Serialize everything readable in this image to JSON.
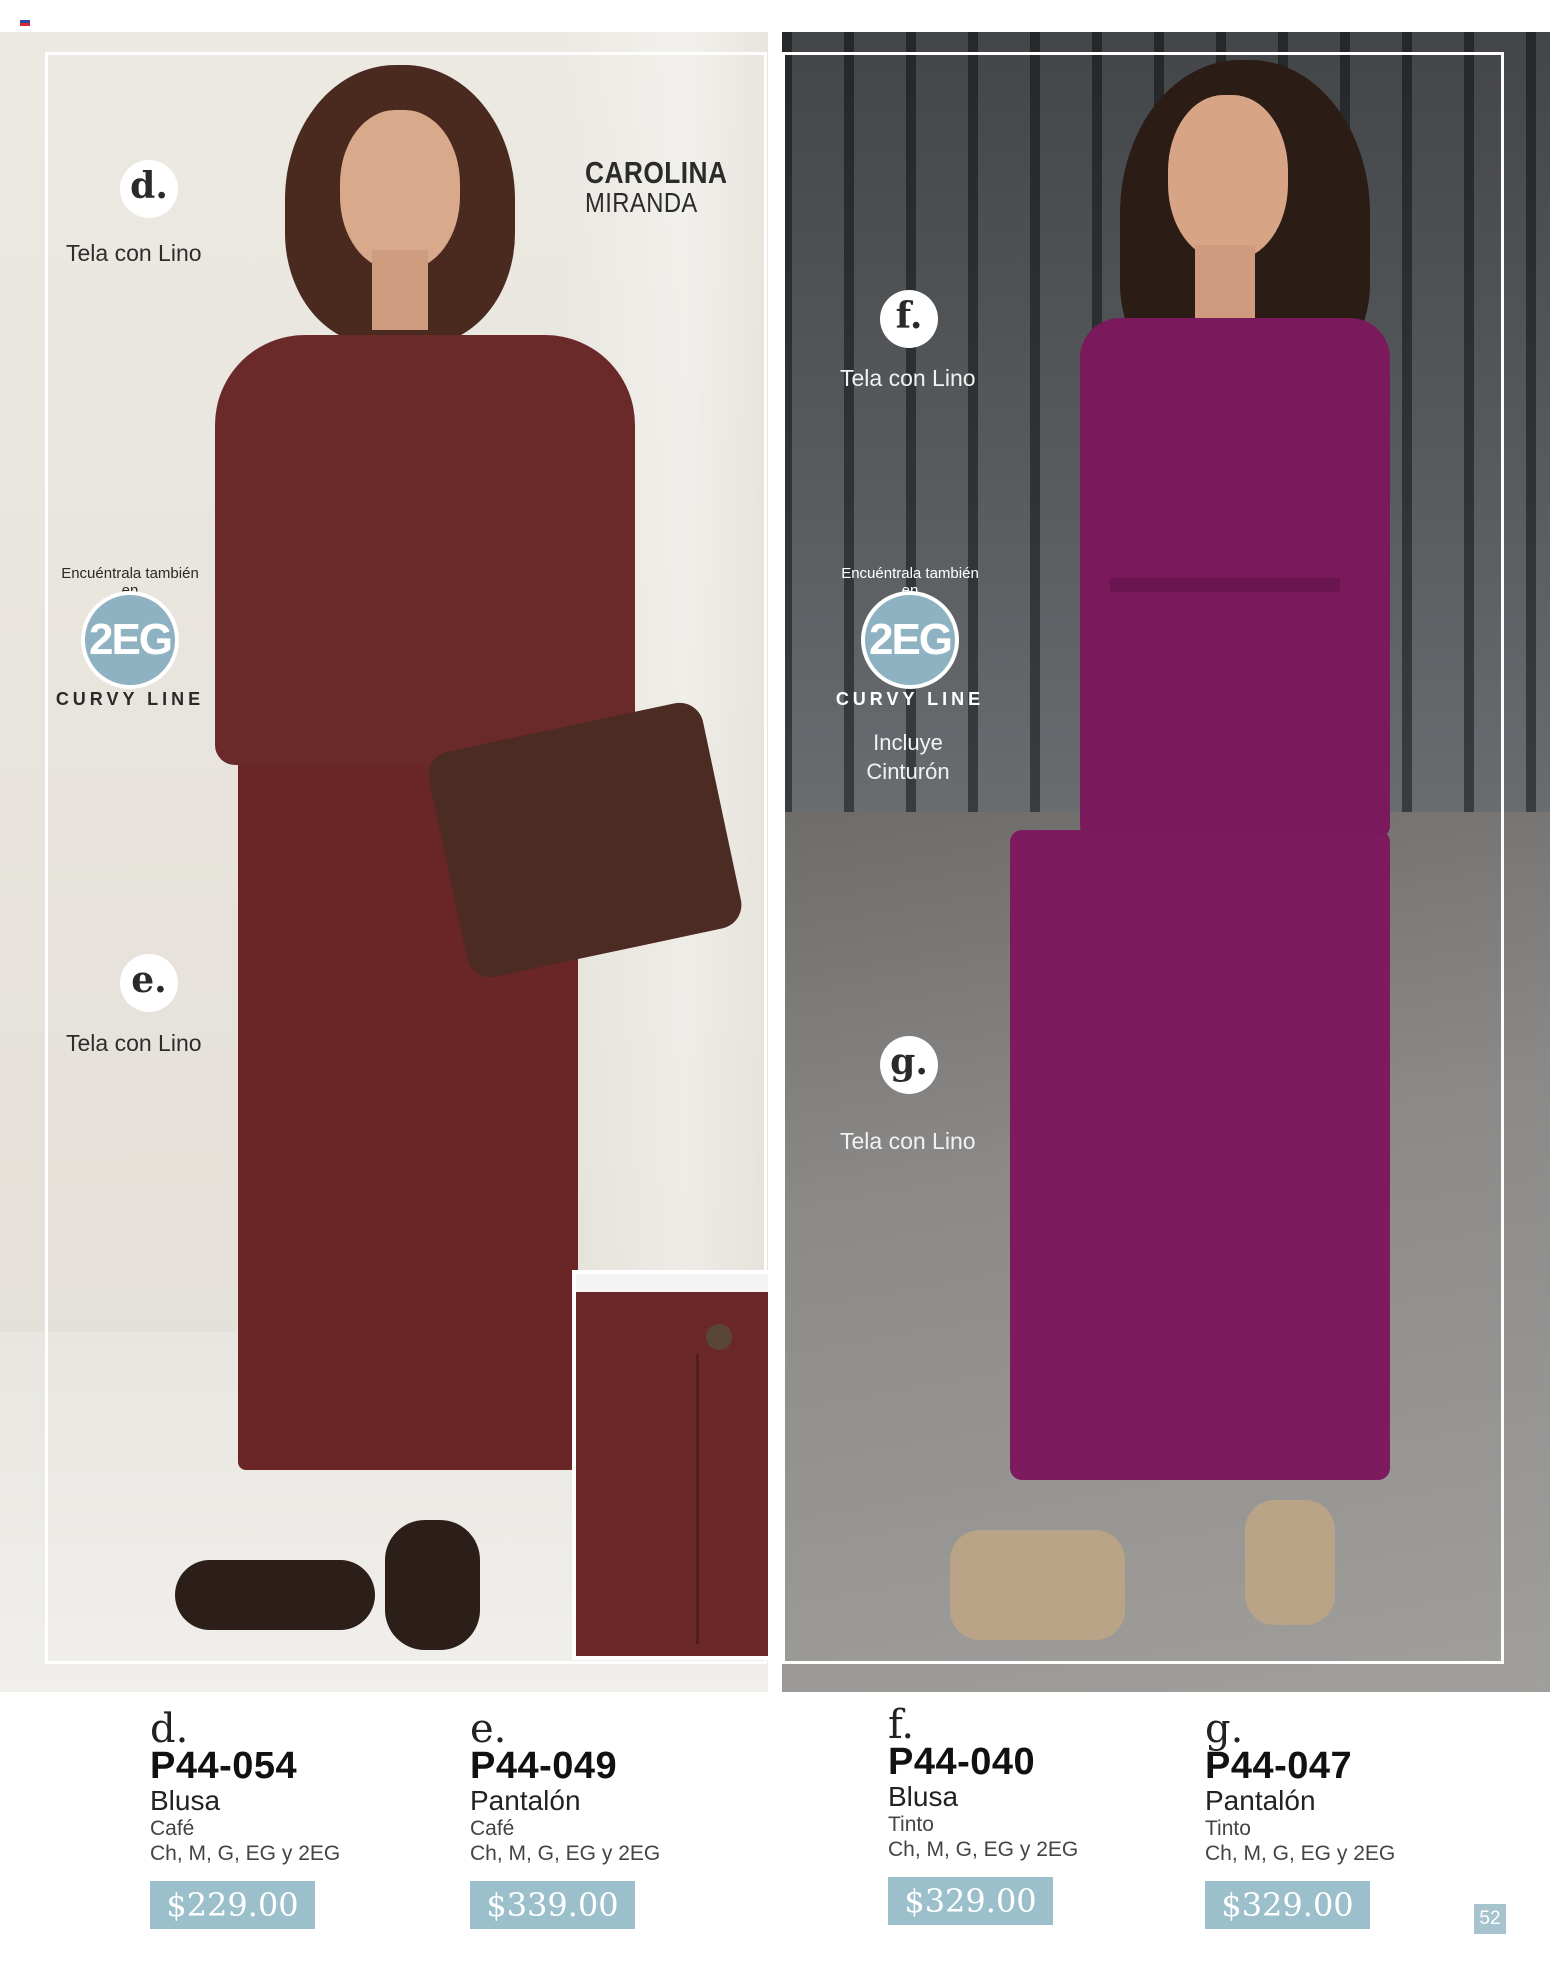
{
  "designer": {
    "first": "CAROLINA",
    "last": "MIRANDA"
  },
  "badges": [
    {
      "letter": "d.",
      "fabric": "Tela con Lino"
    },
    {
      "letter": "e.",
      "fabric": "Tela con Lino"
    },
    {
      "letter": "f.",
      "fabric": "Tela con Lino"
    },
    {
      "letter": "g.",
      "fabric": "Tela con Lino"
    }
  ],
  "stamp": {
    "arc_top": "Encuéntrala también en",
    "code": "2EG",
    "arc_bottom": "CURVY LINE"
  },
  "belt_note": "Incluye Cinturón",
  "products": [
    {
      "letter": "d.",
      "code": "P44-054",
      "name": "Blusa",
      "color": "Café",
      "sizes": "Ch, M, G, EG y 2EG",
      "price": "$229.00"
    },
    {
      "letter": "e.",
      "code": "P44-049",
      "name": "Pantalón",
      "color": "Café",
      "sizes": "Ch, M, G, EG y 2EG",
      "price": "$339.00"
    },
    {
      "letter": "f.",
      "code": "P44-040",
      "name": "Blusa",
      "color": "Tinto",
      "sizes": "Ch, M, G, EG y 2EG",
      "price": "$329.00"
    },
    {
      "letter": "g.",
      "code": "P44-047",
      "name": "Pantalón",
      "color": "Tinto",
      "sizes": "Ch, M, G, EG y 2EG",
      "price": "$329.00"
    }
  ],
  "page_number": "52",
  "colors": {
    "price_bg": "#9cbfcc",
    "cafe": "#6b2a2a",
    "tinto": "#7a1a5c"
  }
}
